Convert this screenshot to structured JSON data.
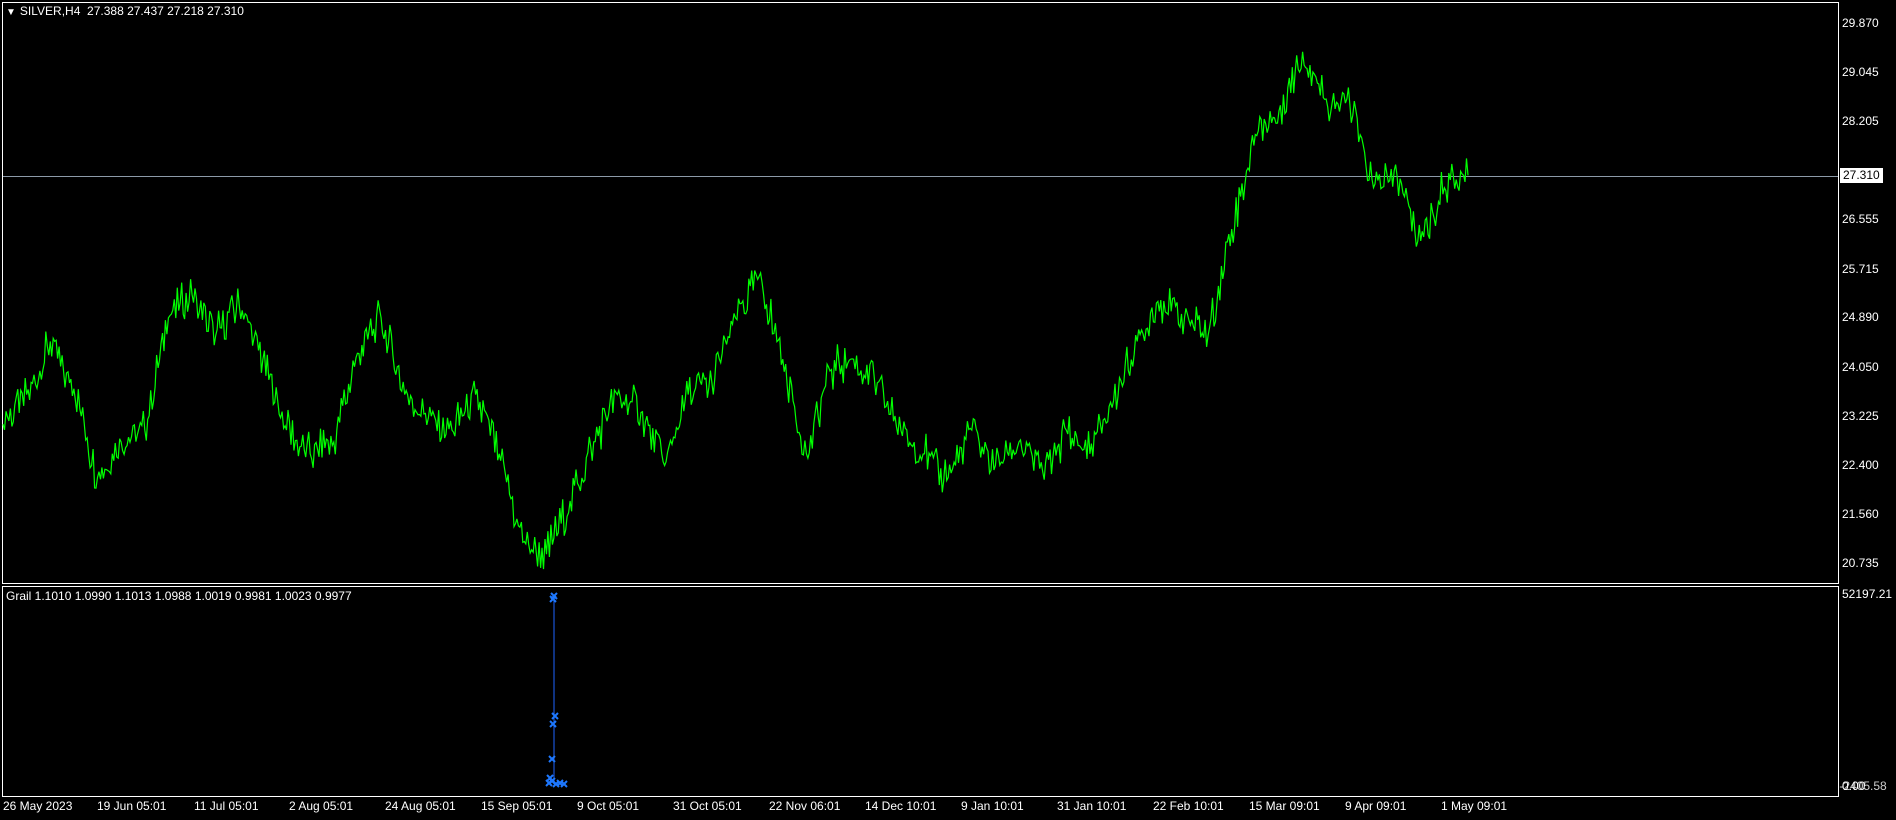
{
  "main_panel": {
    "symbol_label": "SILVER,H4",
    "ohlc_label": "27.388 27.437 27.218 27.310",
    "current_price": "27.310",
    "line_color": "#00ff00",
    "price_line_color": "#8c9aa8"
  },
  "indicator_panel": {
    "label": "Grail 1.1010 1.0990 1.1013 1.0988 1.0019 0.9981 1.0023 0.9977",
    "scale_max": "52197.21",
    "scale_min": "0.00",
    "scale_min_overlap": "-2405.58",
    "marker_color": "#1e78ff",
    "marker_icon": "x-marker-icon"
  },
  "y_axis_ticks": [
    "29.870",
    "29.045",
    "28.205",
    "27.310",
    "26.555",
    "25.715",
    "24.890",
    "24.050",
    "23.225",
    "22.400",
    "21.560",
    "20.735"
  ],
  "x_axis_ticks": [
    "26 May 2023",
    "19 Jun 05:01",
    "11 Jul 05:01",
    "2 Aug 05:01",
    "24 Aug 05:01",
    "15 Sep 05:01",
    "9 Oct 05:01",
    "31 Oct 05:01",
    "22 Nov 06:01",
    "14 Dec 10:01",
    "9 Jan 10:01",
    "31 Jan 10:01",
    "22 Feb 10:01",
    "15 Mar 09:01",
    "9 Apr 09:01",
    "1 May 09:01"
  ],
  "chart_data": {
    "type": "line",
    "title": "SILVER,H4",
    "y_range": [
      20.4,
      30.2
    ],
    "series": [
      {
        "name": "SILVER,H4",
        "points": [
          [
            "26 May 2023",
            23.1
          ],
          [
            "2 Jun",
            23.6
          ],
          [
            "9 Jun",
            24.5
          ],
          [
            "14 Jun",
            23.7
          ],
          [
            "19 Jun 05:01",
            22.2
          ],
          [
            "26 Jun",
            22.8
          ],
          [
            "4 Jul",
            23.0
          ],
          [
            "11 Jul 05:01",
            24.9
          ],
          [
            "14 Jul",
            25.3
          ],
          [
            "18 Jul",
            24.6
          ],
          [
            "21 Jul",
            25.1
          ],
          [
            "25 Jul",
            24.2
          ],
          [
            "2 Aug 05:01",
            23.0
          ],
          [
            "8 Aug",
            22.6
          ],
          [
            "15 Aug",
            22.8
          ],
          [
            "21 Aug",
            24.3
          ],
          [
            "24 Aug 05:01",
            24.9
          ],
          [
            "30 Aug",
            23.6
          ],
          [
            "5 Sep",
            23.2
          ],
          [
            "11 Sep",
            23.0
          ],
          [
            "15 Sep 05:01",
            23.6
          ],
          [
            "19 Sep",
            22.6
          ],
          [
            "22 Sep",
            21.1
          ],
          [
            "27 Sep",
            20.9
          ],
          [
            "2 Oct",
            21.8
          ],
          [
            "9 Oct 05:01",
            22.8
          ],
          [
            "16 Oct",
            23.6
          ],
          [
            "23 Oct",
            23.3
          ],
          [
            "31 Oct 05:01",
            22.4
          ],
          [
            "3 Nov",
            23.6
          ],
          [
            "10 Nov",
            23.8
          ],
          [
            "17 Nov",
            24.9
          ],
          [
            "22 Nov 06:01",
            25.6
          ],
          [
            "28 Nov",
            24.2
          ],
          [
            "4 Dec",
            22.6
          ],
          [
            "8 Dec",
            24.0
          ],
          [
            "14 Dec 10:01",
            24.2
          ],
          [
            "20 Dec",
            23.8
          ],
          [
            "29 Dec",
            23.0
          ],
          [
            "9 Jan 10:01",
            22.6
          ],
          [
            "16 Jan",
            22.2
          ],
          [
            "24 Jan",
            23.0
          ],
          [
            "31 Jan 10:01",
            22.4
          ],
          [
            "5 Feb",
            22.8
          ],
          [
            "12 Feb",
            22.3
          ],
          [
            "16 Feb",
            23.0
          ],
          [
            "22 Feb 10:01",
            22.6
          ],
          [
            "29 Feb",
            23.5
          ],
          [
            "5 Mar",
            24.5
          ],
          [
            "11 Mar",
            25.2
          ],
          [
            "15 Mar 09:01",
            24.9
          ],
          [
            "20 Mar",
            24.6
          ],
          [
            "27 Mar",
            26.4
          ],
          [
            "3 Apr",
            28.0
          ],
          [
            "9 Apr 09:01",
            28.4
          ],
          [
            "12 Apr",
            29.4
          ],
          [
            "15 Apr",
            28.6
          ],
          [
            "18 Apr",
            28.5
          ],
          [
            "22 Apr",
            27.1
          ],
          [
            "26 Apr",
            27.3
          ],
          [
            "1 May 09:01",
            26.2
          ],
          [
            "3 May",
            27.1
          ],
          [
            "5 May",
            27.31
          ]
        ]
      }
    ]
  }
}
